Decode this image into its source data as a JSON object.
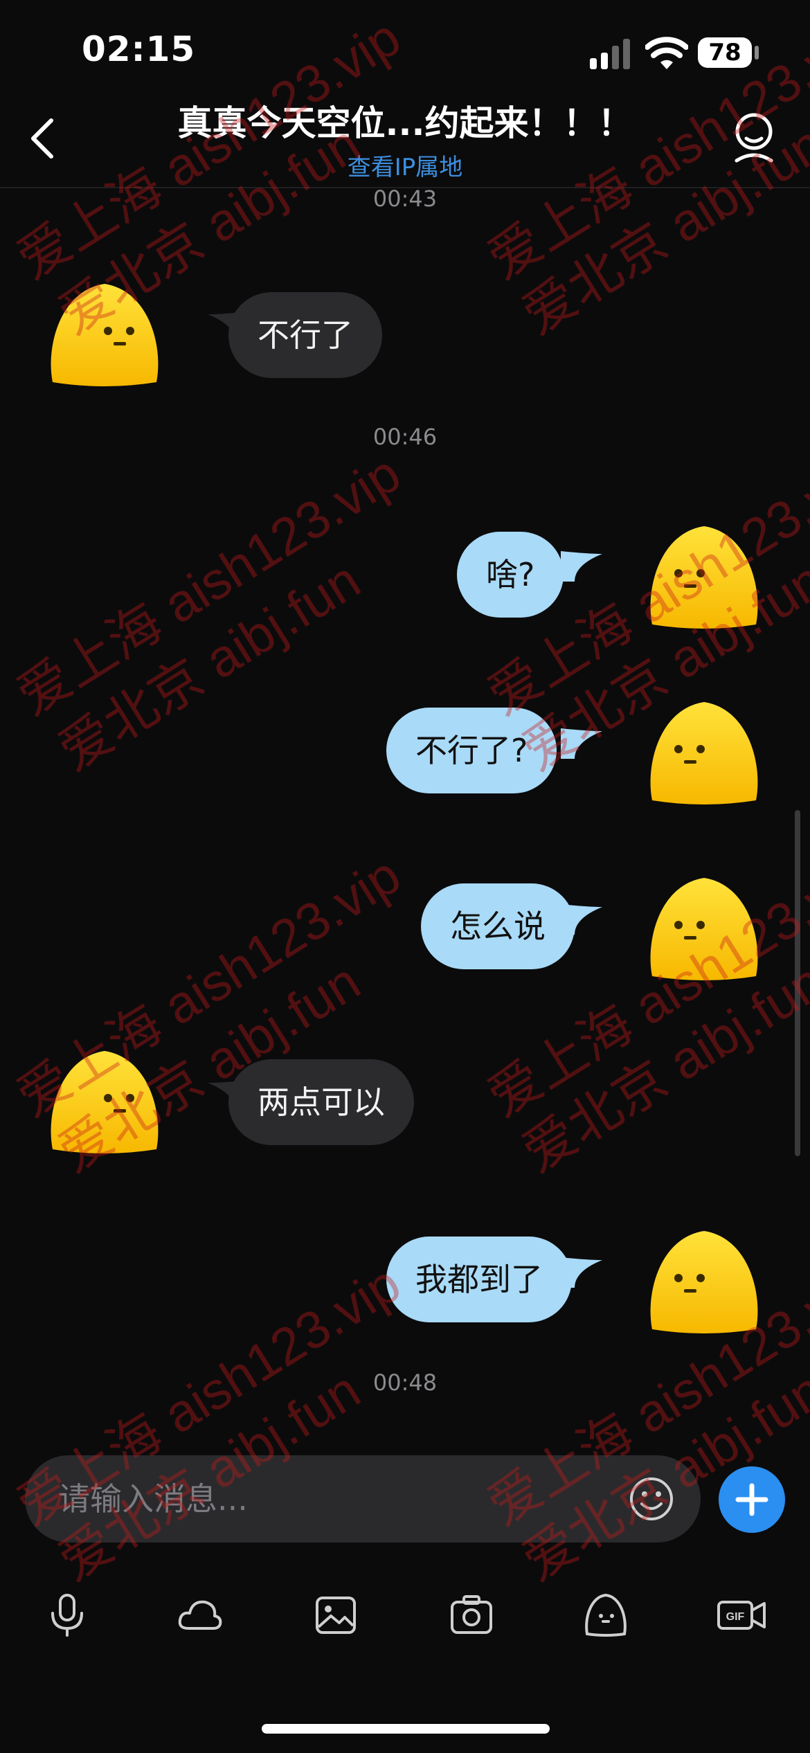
{
  "status_bar": {
    "time": "02:15",
    "battery": "78"
  },
  "header": {
    "title": "真真今天空位...约起来！！！",
    "subtitle": "查看IP属地"
  },
  "messages": {
    "ts_1": "00:43",
    "m1": "不行了",
    "ts_2": "00:46",
    "m2": "啥?",
    "m3": "不行了?",
    "m4": "怎么说",
    "m5": "两点可以",
    "m6": "我都到了",
    "ts_3": "00:48"
  },
  "input": {
    "placeholder": "请输入消息..."
  },
  "toolbar": [
    "mic-icon",
    "cloud-icon",
    "image-icon",
    "camera-icon",
    "sticker-icon",
    "gif-icon"
  ],
  "watermark": {
    "line1": "爱上海 aish123.vip",
    "line2": "爱北京 aibj.fun"
  },
  "colors": {
    "outgoing_bubble": "#a9daf7",
    "incoming_bubble": "#2b2b2e",
    "accent": "#2a8ff0",
    "link": "#3d8fdf"
  }
}
